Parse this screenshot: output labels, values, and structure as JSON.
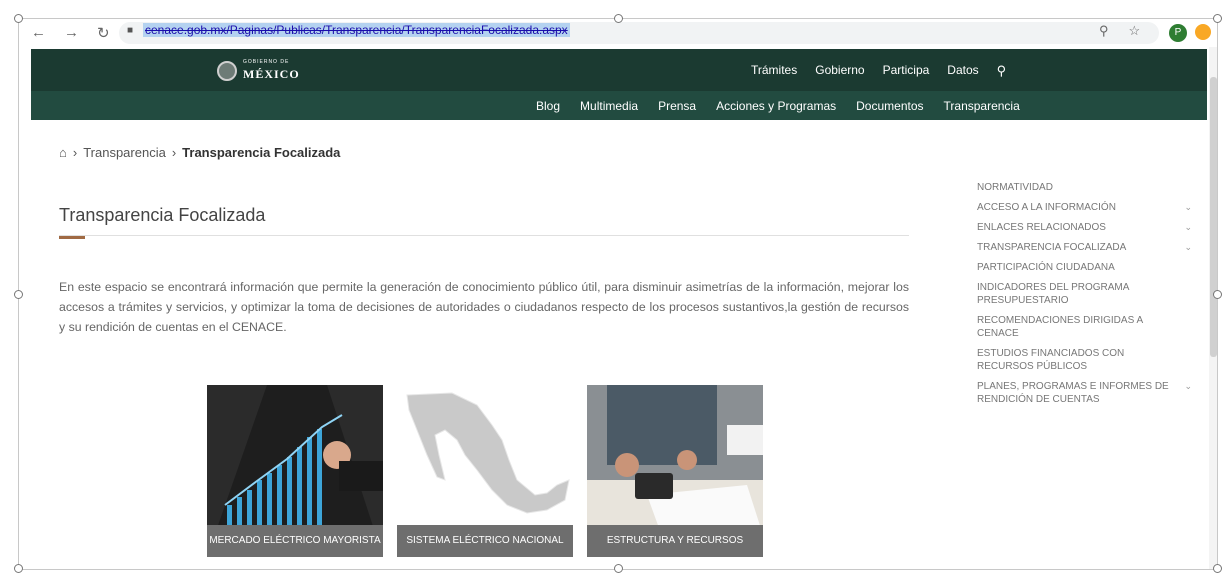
{
  "browser": {
    "url": "cenace.gob.mx/Paginas/Publicas/Transparencia/TransparenciaFocalizada.aspx",
    "avatar_letter": "P"
  },
  "header": {
    "logo_small": "GOBIERNO DE",
    "logo_big": "MÉXICO",
    "top_nav": [
      "Trámites",
      "Gobierno",
      "Participa",
      "Datos"
    ],
    "sub_nav": [
      "Blog",
      "Multimedia",
      "Prensa",
      "Acciones y Programas",
      "Documentos",
      "Transparencia"
    ]
  },
  "breadcrumb": {
    "parent": "Transparencia",
    "current": "Transparencia Focalizada"
  },
  "main": {
    "title": "Transparencia Focalizada",
    "intro": "En este espacio se encontrará información que permite la generación de conocimiento público útil, para disminuir asimetrías de la información, mejorar los accesos a trámites y servicios, y optimizar la toma de decisiones de autoridades o ciudadanos respecto de los procesos sustantivos,la gestión de recursos y su rendición de cuentas en el CENACE."
  },
  "sidebar": {
    "items": [
      {
        "label": "Normatividad",
        "has_submenu": false
      },
      {
        "label": "Acceso a la información",
        "has_submenu": true
      },
      {
        "label": "Enlaces relacionados",
        "has_submenu": true
      },
      {
        "label": "Transparencia focalizada",
        "has_submenu": true
      },
      {
        "label": "Participación ciudadana",
        "has_submenu": false
      },
      {
        "label": "Indicadores del programa presupuestario",
        "has_submenu": false
      },
      {
        "label": "Recomendaciones dirigidas a CENACE",
        "has_submenu": false
      },
      {
        "label": "Estudios financiados con recursos públicos",
        "has_submenu": false
      },
      {
        "label": "Planes, programas e informes de rendición de cuentas",
        "has_submenu": true
      }
    ]
  },
  "cards": [
    {
      "label": "Mercado Eléctrico Mayorista"
    },
    {
      "label": "Sistema Eléctrico Nacional"
    },
    {
      "label": "Estructura y Recursos"
    }
  ],
  "colors": {
    "header_dark": "#1b3a31",
    "header_sub": "#224b40",
    "title_accent": "#a06a44",
    "card_label_bg": "#6e6e6e"
  }
}
